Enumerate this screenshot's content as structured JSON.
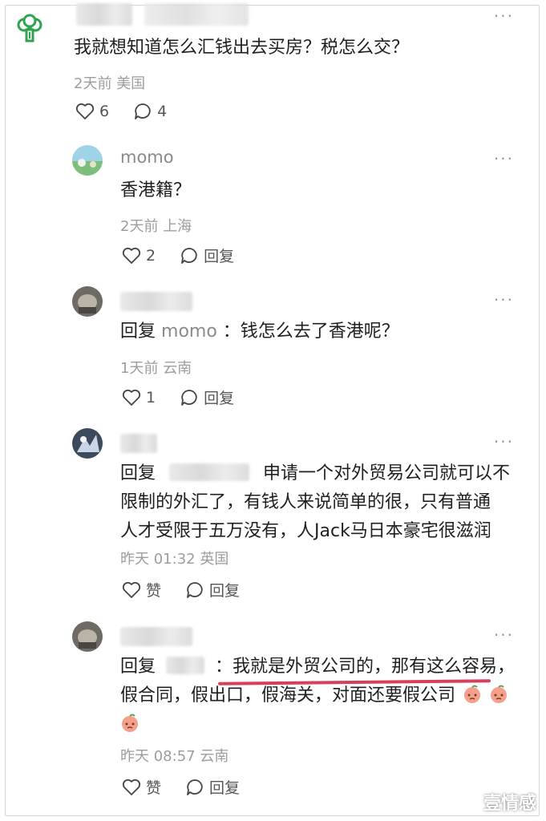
{
  "comments": [
    {
      "text": "我就想知道怎么汇钱出去买房？税怎么交？",
      "time": "2天前",
      "location": "美国",
      "likes": "6",
      "replies": "4"
    },
    {
      "username": "momo",
      "text": "香港籍？",
      "time": "2天前",
      "location": "上海",
      "likes": "2",
      "reply_label": "回复"
    },
    {
      "reply_prefix": "回复",
      "reply_to": "momo",
      "text": "：钱怎么去了香港呢？",
      "time": "1天前",
      "location": "云南",
      "likes": "1",
      "reply_label": "回复"
    },
    {
      "reply_prefix": "回复",
      "text_line1": "申请一个对外贸易公司就可以不",
      "text_line2": "限制的外汇了，有钱人来说简单的很，只有普通",
      "text_line3": "人才受限于五万没有，人Jack马日本豪宅很滋润",
      "time": "昨天 01:32",
      "location": "英国",
      "like_label": "赞",
      "reply_label": "回复"
    },
    {
      "reply_prefix": "回复",
      "text_line1": "：我就是外贸公司的，那有这么容易，",
      "text_line2": "假合同，假出口，假海关，对面还要假公司",
      "time": "昨天 08:57",
      "location": "云南",
      "like_label": "赞",
      "reply_label": "回复"
    }
  ],
  "more_icon_text": "···",
  "watermark": "壹情感",
  "colors": {
    "underline": "#d8405a",
    "meta": "#9d9d9d",
    "username": "#8a8a8a"
  }
}
